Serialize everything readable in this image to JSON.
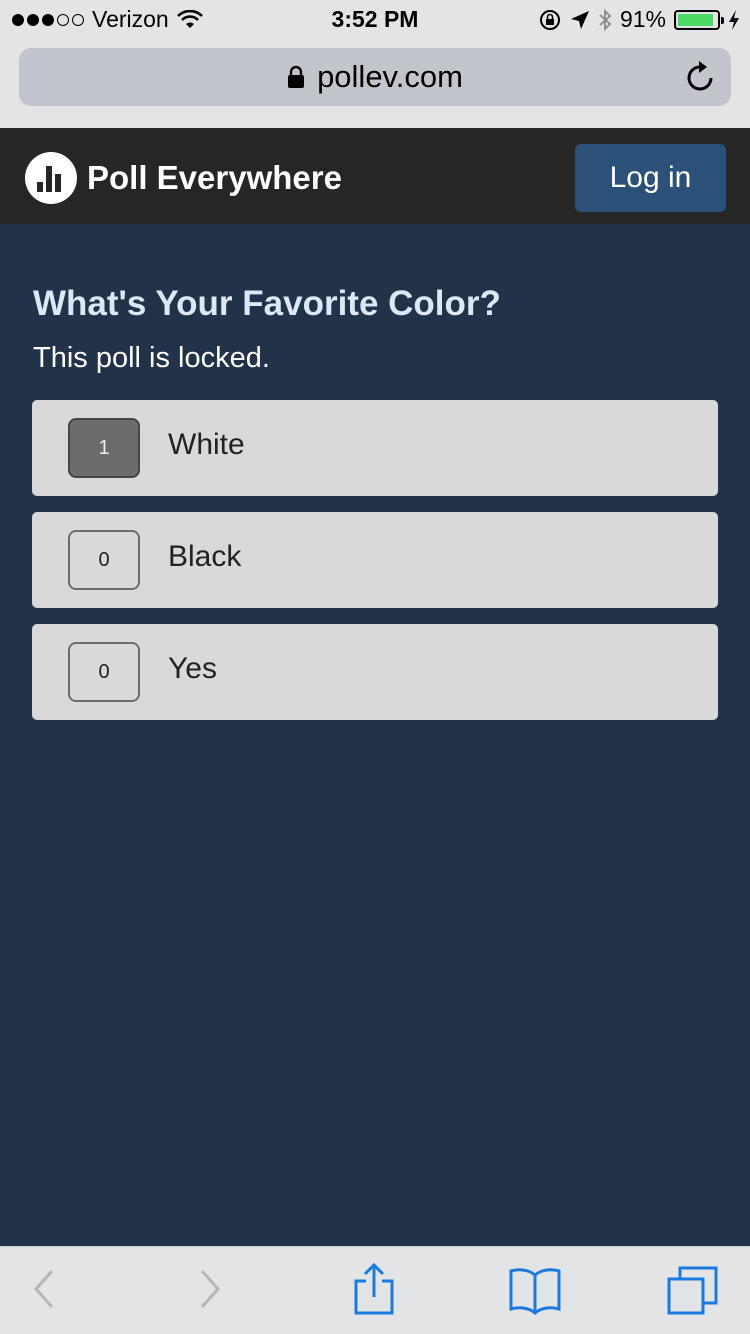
{
  "status_bar": {
    "carrier": "Verizon",
    "time": "3:52 PM",
    "battery": "91%",
    "battery_level": 0.91,
    "signal_bars": 3
  },
  "browser": {
    "url": "pollev.com"
  },
  "header": {
    "brand": "Poll Everywhere",
    "login_label": "Log in"
  },
  "poll": {
    "title": "What's Your Favorite Color?",
    "status": "This poll is locked.",
    "options": [
      {
        "label": "White",
        "count": "1",
        "selected": true
      },
      {
        "label": "Black",
        "count": "0",
        "selected": false
      },
      {
        "label": "Yes",
        "count": "0",
        "selected": false
      }
    ]
  },
  "colors": {
    "background": "#223349",
    "header": "#262626",
    "login_button": "#2b5179",
    "title": "#dbe8f5",
    "option_bg": "#d9d9d9",
    "ios_blue": "#1b7ae0"
  },
  "icons": [
    "wifi-icon",
    "lock-icon",
    "location-icon",
    "bluetooth-icon",
    "reload-icon",
    "back-icon",
    "forward-icon",
    "share-icon",
    "bookmarks-icon",
    "tabs-icon"
  ]
}
